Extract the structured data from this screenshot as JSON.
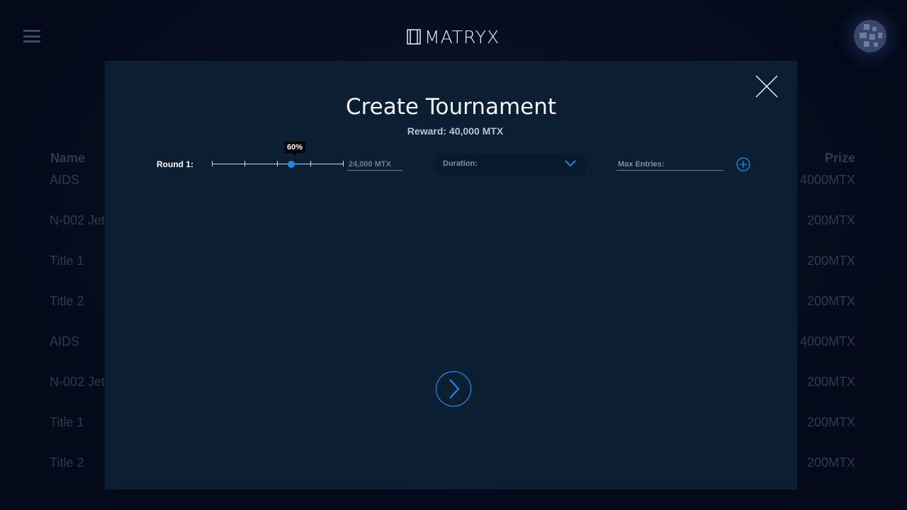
{
  "header": {
    "logo_text": "MATRYX",
    "menu_icon": "hamburger-icon",
    "avatar_icon": "user-avatar"
  },
  "background_table": {
    "col_name": "Name",
    "col_prize": "Prize",
    "rows": [
      {
        "name": "AIDS",
        "prize": "4000MTX"
      },
      {
        "name": "N-002 Jet",
        "prize": "200MTX"
      },
      {
        "name": "Title 1",
        "prize": "200MTX"
      },
      {
        "name": "Title 2",
        "prize": "200MTX"
      },
      {
        "name": "AIDS",
        "prize": "4000MTX"
      },
      {
        "name": "N-002 Jet",
        "prize": "200MTX"
      },
      {
        "name": "Title 1",
        "prize": "200MTX"
      },
      {
        "name": "Title 2",
        "prize": "200MTX"
      }
    ]
  },
  "modal": {
    "title": "Create Tournament",
    "reward": "Reward: 40,000 MTX",
    "close_icon": "close-icon",
    "round": {
      "label": "Round 1:",
      "slider_percent_label": "60%",
      "slider_fraction": 0.6,
      "amount_placeholder": "24,000 MTX",
      "duration_label": "Duration:",
      "max_entries_placeholder": "Max Entries:"
    },
    "add_icon": "plus-circle-icon",
    "next_icon": "chevron-right-icon"
  },
  "colors": {
    "accent": "#1e88e5",
    "modal_bg": "#0b1e32",
    "page_bg": "#040a1a"
  }
}
